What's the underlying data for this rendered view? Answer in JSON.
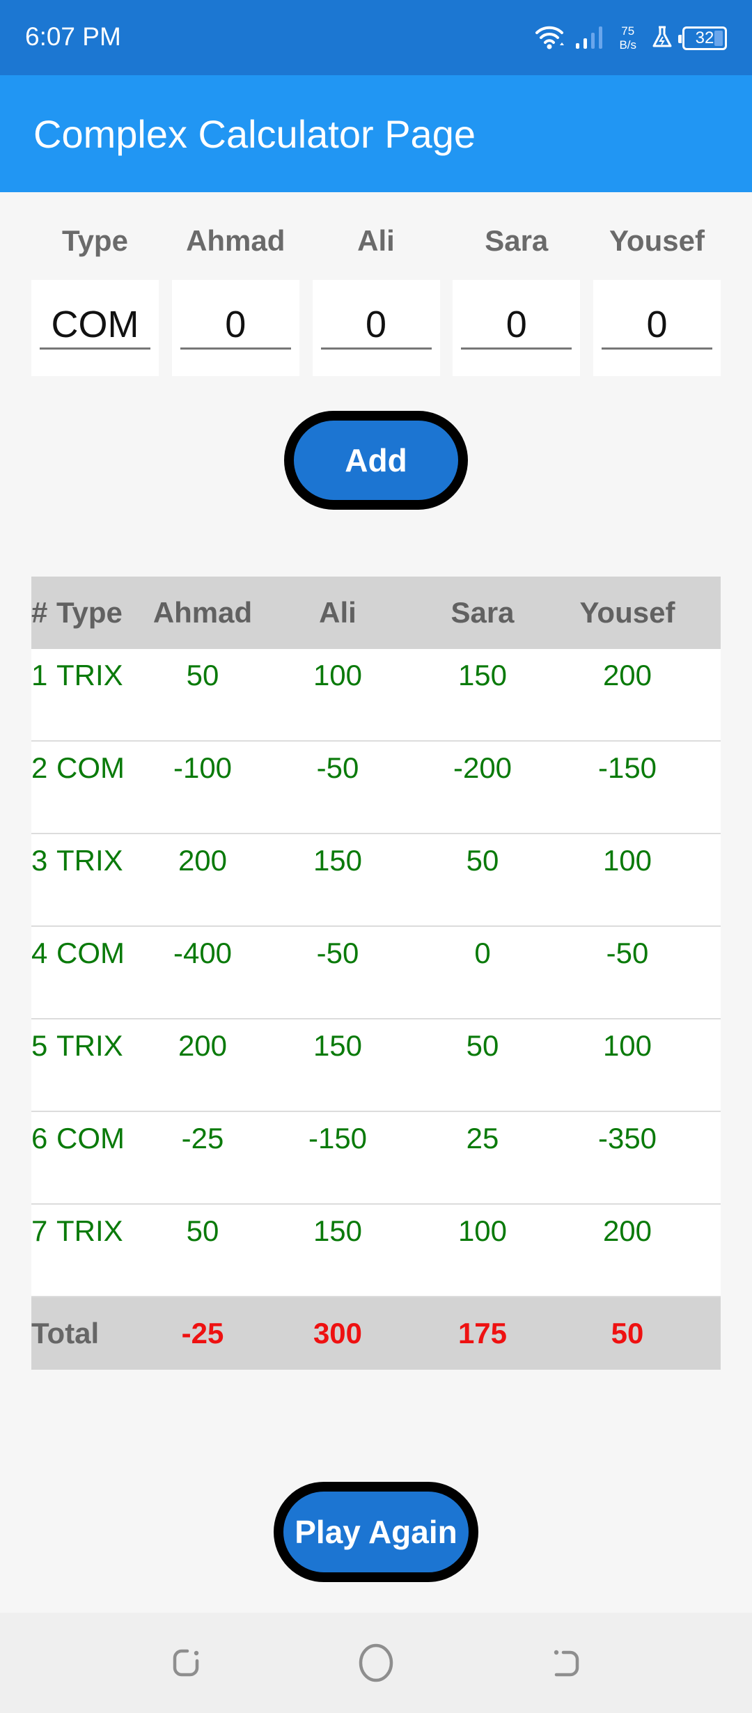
{
  "status_bar": {
    "time": "6:07 PM",
    "net_speed_value": "75",
    "net_speed_unit": "B/s",
    "battery_level": "32",
    "icons": [
      "wifi-icon",
      "signal-icon",
      "lab-flask-icon",
      "battery-icon"
    ]
  },
  "app_bar": {
    "title": "Complex Calculator Page"
  },
  "input_form": {
    "labels": [
      "Type",
      "Ahmad",
      "Ali",
      "Sara",
      "Yousef"
    ],
    "values": [
      "COM",
      "0",
      "0",
      "0",
      "0"
    ]
  },
  "buttons": {
    "add": "Add",
    "play_again": "Play Again"
  },
  "table": {
    "headers": [
      "#",
      "Type",
      "Ahmad",
      "Ali",
      "Sara",
      "Yousef"
    ],
    "rows": [
      {
        "num": "1",
        "type": "TRIX",
        "ahmad": "50",
        "ali": "100",
        "sara": "150",
        "yousef": "200"
      },
      {
        "num": "2",
        "type": "COM",
        "ahmad": "-100",
        "ali": "-50",
        "sara": "-200",
        "yousef": "-150"
      },
      {
        "num": "3",
        "type": "TRIX",
        "ahmad": "200",
        "ali": "150",
        "sara": "50",
        "yousef": "100"
      },
      {
        "num": "4",
        "type": "COM",
        "ahmad": "-400",
        "ali": "-50",
        "sara": "0",
        "yousef": "-50"
      },
      {
        "num": "5",
        "type": "TRIX",
        "ahmad": "200",
        "ali": "150",
        "sara": "50",
        "yousef": "100"
      },
      {
        "num": "6",
        "type": "COM",
        "ahmad": "-25",
        "ali": "-150",
        "sara": "25",
        "yousef": "-350"
      },
      {
        "num": "7",
        "type": "TRIX",
        "ahmad": "50",
        "ali": "150",
        "sara": "100",
        "yousef": "200"
      }
    ],
    "total": {
      "label": "Total",
      "ahmad": "-25",
      "ali": "300",
      "sara": "175",
      "yousef": "50"
    }
  },
  "colors": {
    "status_bar": "#1c77d2",
    "app_bar": "#2196f3",
    "button": "#1c75d2",
    "row_text": "#0a7a0a",
    "total_text": "#ee1111",
    "header_bg": "#d3d3d3"
  },
  "nav_bar": {
    "icons": [
      "recent-apps-icon",
      "home-icon",
      "back-icon"
    ]
  }
}
